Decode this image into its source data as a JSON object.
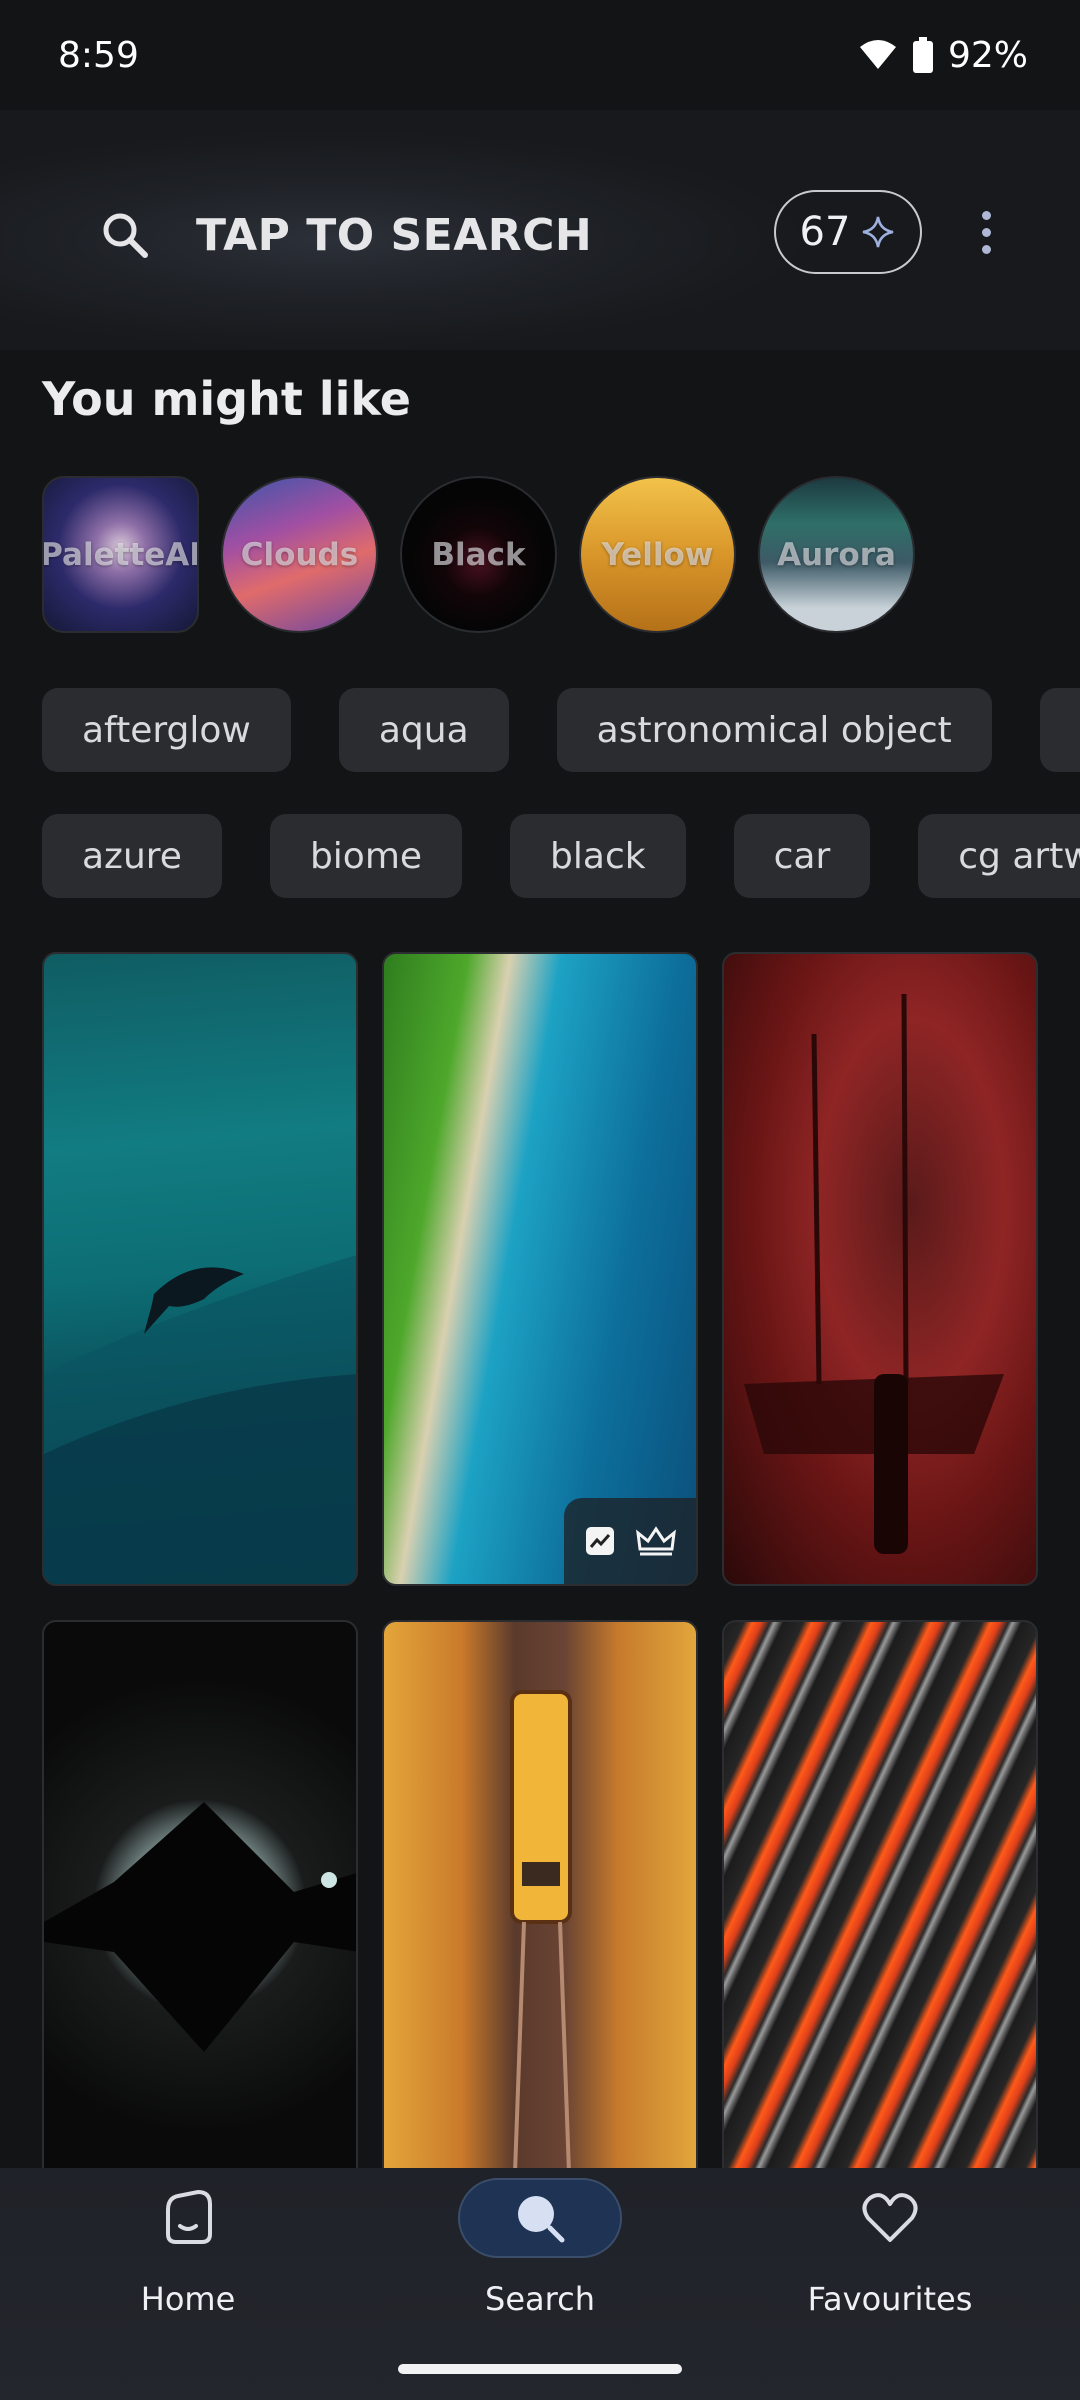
{
  "status_bar": {
    "time": "8:59",
    "battery": "92%"
  },
  "search": {
    "placeholder_text": "TAP TO SEARCH",
    "credits_count": "67"
  },
  "suggestions": {
    "title": "You might like",
    "collections": [
      {
        "label": "PaletteAI",
        "shape": "square"
      },
      {
        "label": "Clouds",
        "shape": "round"
      },
      {
        "label": "Black",
        "shape": "round"
      },
      {
        "label": "Yellow",
        "shape": "round"
      },
      {
        "label": "Aurora",
        "shape": "round"
      }
    ],
    "tags_row1": [
      "afterglow",
      "aqua",
      "astronomical object",
      ""
    ],
    "tags_row2": [
      "azure",
      "biome",
      "black",
      "car",
      "cg artw"
    ]
  },
  "wallpapers": [
    {
      "subject": "shark silhouette teal waves"
    },
    {
      "subject": "aerial coastline ocean",
      "badges": [
        "trending-icon",
        "crown-icon"
      ]
    },
    {
      "subject": "red pirate ship"
    },
    {
      "subject": "moon mountain reflection"
    },
    {
      "subject": "train through autumn trees"
    },
    {
      "subject": "orange black fluid marble"
    }
  ],
  "bottom_nav": {
    "items": [
      {
        "label": "Home",
        "icon": "home-face-icon"
      },
      {
        "label": "Search",
        "icon": "search-icon",
        "active": true
      },
      {
        "label": "Favourites",
        "icon": "heart-icon"
      }
    ]
  },
  "colors": {
    "background": "#121416",
    "active_nav": "#1f3454",
    "tag_bg": "#2a2c2f"
  }
}
